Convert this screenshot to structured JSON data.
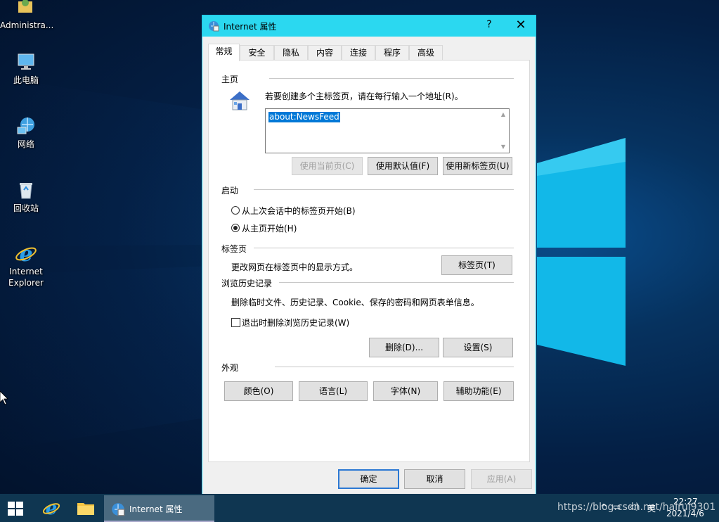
{
  "desktop": {
    "icons": [
      {
        "label": "Administra..."
      },
      {
        "label": "此电脑"
      },
      {
        "label": "网络"
      },
      {
        "label": "回收站"
      },
      {
        "label": "Internet Explorer"
      }
    ]
  },
  "dialog": {
    "title": "Internet 属性",
    "help": "?",
    "close": "✕",
    "tabs": [
      {
        "label": "常规",
        "active": true
      },
      {
        "label": "安全"
      },
      {
        "label": "隐私"
      },
      {
        "label": "内容"
      },
      {
        "label": "连接"
      },
      {
        "label": "程序"
      },
      {
        "label": "高级"
      }
    ],
    "home": {
      "section": "主页",
      "instruction": "若要创建多个主标签页，请在每行输入一个地址(R)。",
      "address_value": "about:NewsFeed",
      "btn_current": "使用当前页(C)",
      "btn_default": "使用默认值(F)",
      "btn_newtab": "使用新标签页(U)"
    },
    "startup": {
      "section": "启动",
      "option_last": "从上次会话中的标签页开始(B)",
      "option_home": "从主页开始(H)"
    },
    "tabs_section": {
      "section": "标签页",
      "description": "更改网页在标签页中的显示方式。",
      "btn": "标签页(T)"
    },
    "history": {
      "section": "浏览历史记录",
      "description": "删除临时文件、历史记录、Cookie、保存的密码和网页表单信息。",
      "checkbox": "退出时删除浏览历史记录(W)",
      "btn_delete": "删除(D)...",
      "btn_settings": "设置(S)"
    },
    "appearance": {
      "section": "外观",
      "btn_colors": "颜色(O)",
      "btn_languages": "语言(L)",
      "btn_fonts": "字体(N)",
      "btn_accessibility": "辅助功能(E)"
    },
    "footer": {
      "ok": "确定",
      "cancel": "取消",
      "apply": "应用(A)"
    }
  },
  "taskbar": {
    "active_window": "Internet 属性",
    "tray_lang": "英",
    "time": "22:27",
    "date": "2021/4/6"
  },
  "watermark": "https://blog.csdn.net/hairui9301",
  "colors": {
    "titlebar": "#2bd8f0",
    "selection": "#0078d7",
    "taskbar": "#0f3651"
  }
}
